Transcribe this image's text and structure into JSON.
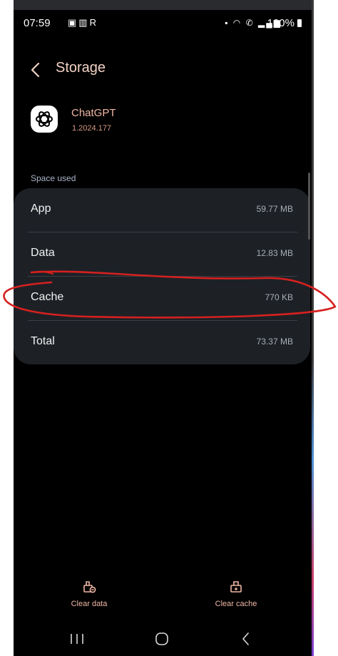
{
  "status_bar": {
    "time": "07:59",
    "left_icons": [
      "notification-a-icon",
      "notification-tablet-icon",
      "notification-r-icon"
    ],
    "right_icons": [
      "battery-saver-icon",
      "wifi-icon",
      "wifi-calling-icon",
      "signal-icon"
    ],
    "battery": "100%"
  },
  "header": {
    "title": "Storage"
  },
  "app": {
    "name": "ChatGPT",
    "version": "1.2024.177"
  },
  "space_used": {
    "label": "Space used",
    "rows": [
      {
        "label": "App",
        "value": "59.77 MB"
      },
      {
        "label": "Data",
        "value": "12.83 MB"
      },
      {
        "label": "Cache",
        "value": "770 KB"
      },
      {
        "label": "Total",
        "value": "73.37 MB"
      }
    ]
  },
  "actions": {
    "clear_data": "Clear data",
    "clear_cache": "Clear cache"
  },
  "colors": {
    "background": "#000000",
    "card": "#1d2126",
    "accent": "#f0b7a4",
    "annotation": "#d6201f"
  }
}
